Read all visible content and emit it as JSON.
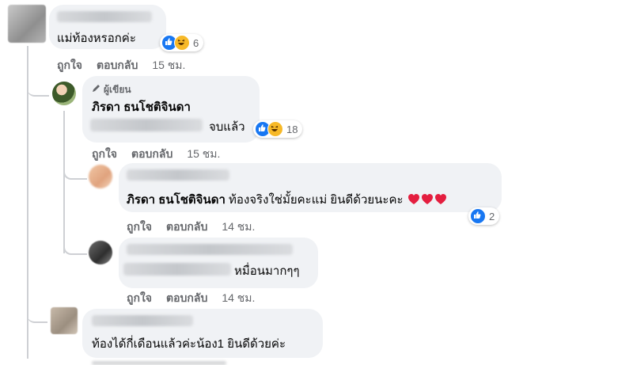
{
  "comment1": {
    "text": "แม่ท้องหรอกค่ะ",
    "reaction_count": "6",
    "actions": {
      "like": "ถูกใจ",
      "reply": "ตอบกลับ",
      "time": "15 ชม."
    }
  },
  "reply1": {
    "author_tag": "ผู้เขียน",
    "author": "ภิรดา ธนโชติจินดา",
    "text": "จบแล้ว",
    "reaction_count": "18",
    "actions": {
      "like": "ถูกใจ",
      "reply": "ตอบกลับ",
      "time": "15 ชม."
    }
  },
  "reply2": {
    "mention": "ภิรดา ธนโชติจินดา",
    "text": "ท้องจริงใช่มั้ยคะแม่ ยินดีด้วยนะคะ",
    "reaction_count": "2",
    "actions": {
      "like": "ถูกใจ",
      "reply": "ตอบกลับ",
      "time": "14 ชม."
    }
  },
  "reply3": {
    "text": "หมื่อนมากๆๆ",
    "actions": {
      "like": "ถูกใจ",
      "reply": "ตอบกลับ",
      "time": "14 ชม."
    }
  },
  "reply4": {
    "text": "ท้องได้กี่เดือนแล้วค่ะน้อง1 ยินดีด้วยค่ะ"
  },
  "colors": {
    "like": "#1877f2",
    "haha": "#f7b928",
    "heart": "#e41e3f",
    "bubble": "#f0f2f5"
  }
}
